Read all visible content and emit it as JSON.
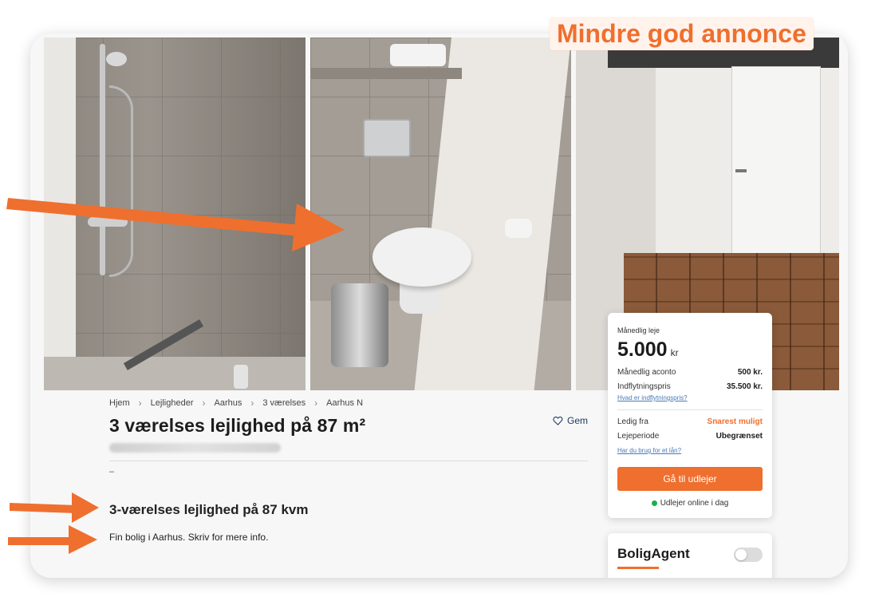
{
  "overlay": {
    "badge": "Mindre god annonce",
    "accent_color": "#ef6f2e"
  },
  "photos": [
    "bathroom-shower",
    "bathroom-toilet",
    "basement-hallway"
  ],
  "breadcrumb": [
    "Hjem",
    "Lejligheder",
    "Aarhus",
    "3 værelses",
    "Aarhus N"
  ],
  "listing": {
    "title": "3 værelses lejlighed på 87 m²",
    "save_label": "Gem",
    "dash": "–",
    "subheading": "3-værelses lejlighed på 87 kvm",
    "description": "Fin bolig i Aarhus. Skriv for mere info."
  },
  "price_card": {
    "label": "Månedlig leje",
    "price": "5.000",
    "currency": "kr",
    "aconto_label": "Månedlig aconto",
    "aconto_value": "500 kr.",
    "move_in_label": "Indflytningspris",
    "move_in_value": "35.500 kr.",
    "move_in_link": "Hvad er indflytningspris?",
    "available_label": "Ledig fra",
    "available_value": "Snarest muligt",
    "period_label": "Lejeperiode",
    "period_value": "Ubegrænset",
    "loan_link": "Har du brug for et lån?",
    "cta": "Gå til udlejer",
    "online_status": "Udlejer online i dag"
  },
  "agent": {
    "title": "BoligAgent",
    "toggle_on": false
  }
}
